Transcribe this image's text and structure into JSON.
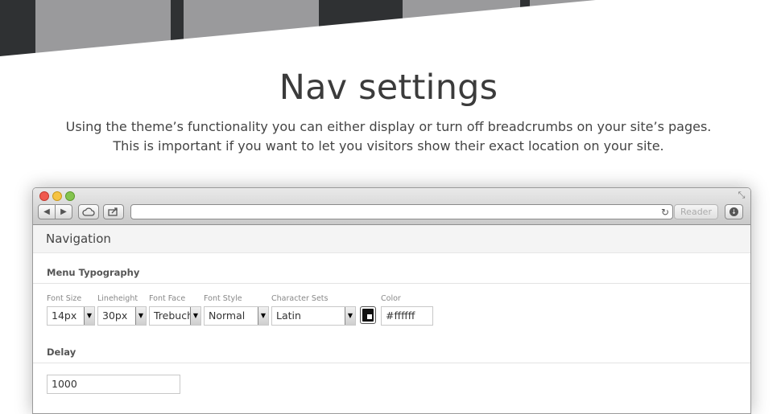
{
  "hero": {
    "title": "Nav settings",
    "description_line1": "Using the theme’s functionality you can either display or turn off breadcrumbs on your site’s pages.",
    "description_line2": "This is important if you want to let you visitors show their exact location on your site."
  },
  "browser": {
    "reader_label": "Reader",
    "address_value": ""
  },
  "page": {
    "section_title": "Navigation",
    "menu_typography": {
      "title": "Menu Typography",
      "fields": {
        "font_size": {
          "label": "Font Size",
          "value": "14px"
        },
        "lineheight": {
          "label": "Lineheight",
          "value": "30px"
        },
        "font_face": {
          "label": "Font Face",
          "value": "Trebuchet"
        },
        "font_style": {
          "label": "Font Style",
          "value": "Normal"
        },
        "character_sets": {
          "label": "Character Sets",
          "value": "Latin"
        },
        "color": {
          "label": "Color",
          "value": "#ffffff"
        }
      }
    },
    "delay": {
      "title": "Delay",
      "value": "1000"
    }
  },
  "colors": {
    "banner_dark": "#2f3133",
    "banner_gray": "#9a9a9c",
    "swatch": "#111111"
  }
}
